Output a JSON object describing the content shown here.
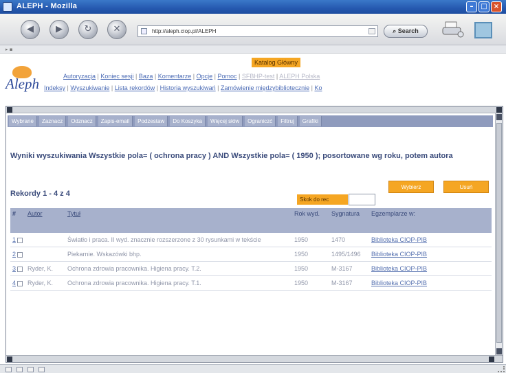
{
  "window": {
    "title": "ALEPH - Mozilla"
  },
  "browser": {
    "address": "http://aleph.ciop.pl/ALEPH",
    "search_label": "Search"
  },
  "header": {
    "katalog": "Katalog Główny",
    "logo_text": "Aleph",
    "links_row1": [
      "Autoryzacja",
      "Koniec sesji",
      "Baza",
      "Komentarze",
      "Opcje",
      "Pomoc"
    ],
    "links_row1_dim": [
      "SFBHP-test",
      "ALEPH Polska"
    ],
    "links_row2": [
      "Indeksy",
      "Wyszukiwanie",
      "Lista rekordów",
      "Historia wyszukiwań",
      "Zamówienie międzybibliotecznie",
      "Ko"
    ]
  },
  "menubar": [
    "Wybrane",
    "Zaznacz",
    "Odznacz",
    "Zapis-email",
    "Podzestaw",
    "Do Koszyka",
    "Więcej słów",
    "Ograniczć",
    "Filtruj",
    "Grafiki"
  ],
  "results": {
    "title": "Wyniki wyszukiwania Wszystkie pola= ( ochrona pracy ) AND Wszystkie pola= ( 1950 ); posortowane wg roku, potem autora",
    "count": "Rekordy 1 - 4 z 4",
    "slownik_label": "Skok do rec",
    "btn_wybierz": "Wybierz",
    "btn_usun": "Usuń"
  },
  "table": {
    "headers": [
      "#",
      "Autor",
      "Tytuł",
      "Rok wyd.",
      "Sygnatura",
      "Egzemplarze w:"
    ],
    "rows": [
      {
        "num": "1",
        "author": "",
        "title": "Światło i praca. II wyd. znacznie rozszerzone z 30 rysunkami w tekście",
        "year": "1950",
        "sig": "1470",
        "copies": "Biblioteka CIOP-PIB"
      },
      {
        "num": "2",
        "author": "",
        "title": "Piekarnie. Wskazówki bhp.",
        "year": "1950",
        "sig": "1495/1496",
        "copies": "Biblioteka CIOP-PIB"
      },
      {
        "num": "3",
        "author": "Ryder, K.",
        "title": "Ochrona zdrowia pracownika. Higiena pracy. T.2.",
        "year": "1950",
        "sig": "M-3167",
        "copies": "Biblioteka CIOP-PIB"
      },
      {
        "num": "4",
        "author": "Ryder, K.",
        "title": "Ochrona zdrowia pracownika. Higiena pracy. T.1.",
        "year": "1950",
        "sig": "M-3167",
        "copies": "Biblioteka CIOP-PIB"
      }
    ]
  }
}
